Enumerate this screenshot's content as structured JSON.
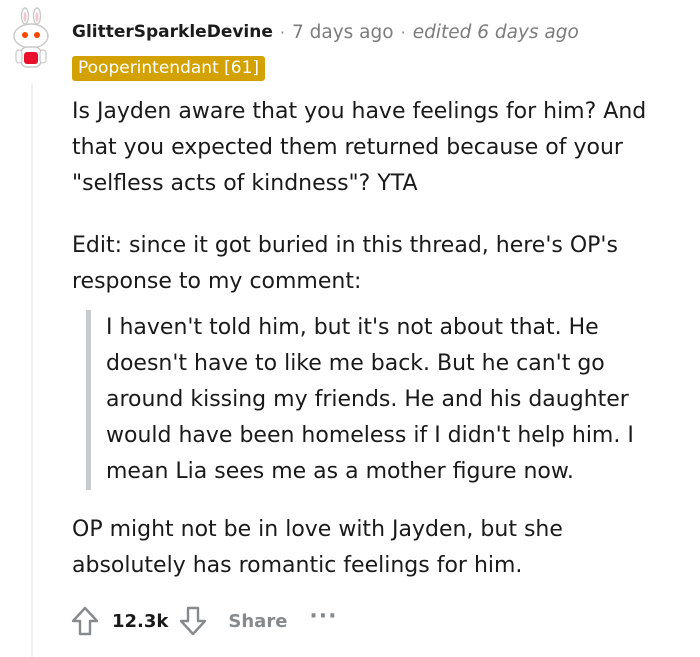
{
  "comment": {
    "username": "GlitterSparkleDevine",
    "separator": "·",
    "posted_time": "7 days ago",
    "edited_time": "edited 6 days ago",
    "flair": "Pooperintendant [61]",
    "paragraphs": [
      "Is Jayden aware that you have feelings for him? And that you expected them returned because of your \"selfless acts of kindness\"? YTA",
      "Edit: since it got buried in this thread, here's OP's response to my comment:",
      "OP might not be in love with Jayden, but she absolutely has romantic feelings for him."
    ],
    "quote": "I haven't told him, but it's not about that. He doesn't have to like me back. But he can't go around kissing my friends. He and his daughter would have been homeless if I didn't help him. I mean Lia sees me as a mother figure now."
  },
  "actions": {
    "score": "12.3k",
    "share_label": "Share",
    "more_label": "···"
  },
  "icons": {
    "upvote": "upvote-arrow-icon",
    "downvote": "downvote-arrow-icon",
    "avatar": "snoo-avatar"
  },
  "colors": {
    "flair_bg": "#d4a200",
    "meta_gray": "#878a8c",
    "quote_bar": "#c8cbcd"
  }
}
